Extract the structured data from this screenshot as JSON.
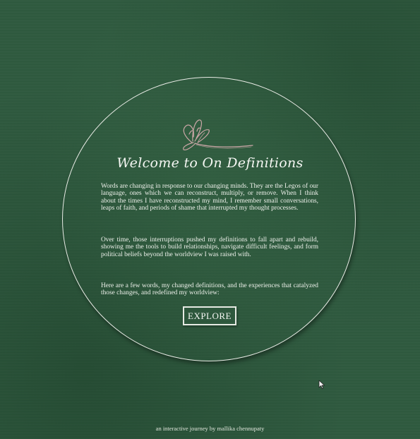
{
  "title": "Welcome to On Definitions",
  "paragraphs": [
    "Words are changing in response to our changing minds. They are the Legos of our language, ones which we can reconstruct, multiply, or remove. When I think about the times I have reconstructed my mind, I remember small conversations, leaps of faith, and periods of shame that interrupted my thought processes.",
    "Over time, those interruptions pushed my definitions to fall apart and rebuild, showing me the tools to build relationships, navigate difficult feelings, and form political beliefs beyond the worldview I was raised with.",
    "Here are a few words, my changed definitions, and the experiences that catalyzed those changes, and redefined my worldview:"
  ],
  "explore_label": "EXPLORE",
  "credit": "an interactive journey by mallika chennupaty",
  "icons": {
    "decoration": "flower-icon",
    "pointer": "cursor-icon"
  },
  "colors": {
    "background": "#2f5a3f",
    "text": "#eef1eb",
    "flower_stroke": "#c9a6a6"
  }
}
